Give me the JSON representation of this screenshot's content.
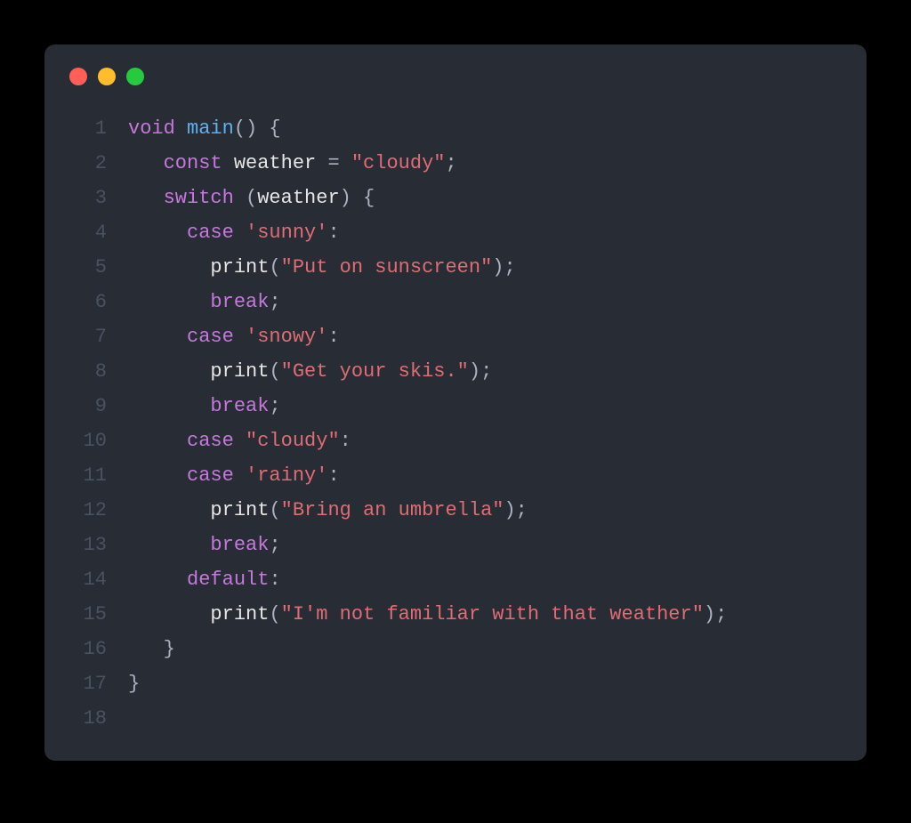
{
  "traffic_lights": {
    "red": "#ff5f56",
    "yellow": "#ffbd2e",
    "green": "#27c93f"
  },
  "code": {
    "lines": [
      {
        "n": "1",
        "tokens": [
          {
            "t": "void",
            "c": "kw"
          },
          {
            "t": " ",
            "c": "op"
          },
          {
            "t": "main",
            "c": "fn"
          },
          {
            "t": "() {",
            "c": "pn"
          }
        ]
      },
      {
        "n": "2",
        "tokens": [
          {
            "t": "   ",
            "c": "op"
          },
          {
            "t": "const",
            "c": "kw"
          },
          {
            "t": " ",
            "c": "op"
          },
          {
            "t": "weather",
            "c": "white"
          },
          {
            "t": " = ",
            "c": "op"
          },
          {
            "t": "\"cloudy\"",
            "c": "strred"
          },
          {
            "t": ";",
            "c": "pn"
          }
        ]
      },
      {
        "n": "3",
        "tokens": [
          {
            "t": "   ",
            "c": "op"
          },
          {
            "t": "switch",
            "c": "kw"
          },
          {
            "t": " (",
            "c": "pn"
          },
          {
            "t": "weather",
            "c": "white"
          },
          {
            "t": ") {",
            "c": "pn"
          }
        ]
      },
      {
        "n": "4",
        "tokens": [
          {
            "t": "     ",
            "c": "op"
          },
          {
            "t": "case",
            "c": "kw"
          },
          {
            "t": " ",
            "c": "op"
          },
          {
            "t": "'sunny'",
            "c": "strred"
          },
          {
            "t": ":",
            "c": "pn"
          }
        ]
      },
      {
        "n": "5",
        "tokens": [
          {
            "t": "       ",
            "c": "op"
          },
          {
            "t": "print",
            "c": "white"
          },
          {
            "t": "(",
            "c": "pn"
          },
          {
            "t": "\"Put on sunscreen\"",
            "c": "strred"
          },
          {
            "t": ");",
            "c": "pn"
          }
        ]
      },
      {
        "n": "6",
        "tokens": [
          {
            "t": "       ",
            "c": "op"
          },
          {
            "t": "break",
            "c": "kw"
          },
          {
            "t": ";",
            "c": "pn"
          }
        ]
      },
      {
        "n": "7",
        "tokens": [
          {
            "t": "     ",
            "c": "op"
          },
          {
            "t": "case",
            "c": "kw"
          },
          {
            "t": " ",
            "c": "op"
          },
          {
            "t": "'snowy'",
            "c": "strred"
          },
          {
            "t": ":",
            "c": "pn"
          }
        ]
      },
      {
        "n": "8",
        "tokens": [
          {
            "t": "       ",
            "c": "op"
          },
          {
            "t": "print",
            "c": "white"
          },
          {
            "t": "(",
            "c": "pn"
          },
          {
            "t": "\"Get your skis.\"",
            "c": "strred"
          },
          {
            "t": ");",
            "c": "pn"
          }
        ]
      },
      {
        "n": "9",
        "tokens": [
          {
            "t": "       ",
            "c": "op"
          },
          {
            "t": "break",
            "c": "kw"
          },
          {
            "t": ";",
            "c": "pn"
          }
        ]
      },
      {
        "n": "10",
        "tokens": [
          {
            "t": "     ",
            "c": "op"
          },
          {
            "t": "case",
            "c": "kw"
          },
          {
            "t": " ",
            "c": "op"
          },
          {
            "t": "\"cloudy\"",
            "c": "strred"
          },
          {
            "t": ":",
            "c": "pn"
          }
        ]
      },
      {
        "n": "11",
        "tokens": [
          {
            "t": "     ",
            "c": "op"
          },
          {
            "t": "case",
            "c": "kw"
          },
          {
            "t": " ",
            "c": "op"
          },
          {
            "t": "'rainy'",
            "c": "strred"
          },
          {
            "t": ":",
            "c": "pn"
          }
        ]
      },
      {
        "n": "12",
        "tokens": [
          {
            "t": "       ",
            "c": "op"
          },
          {
            "t": "print",
            "c": "white"
          },
          {
            "t": "(",
            "c": "pn"
          },
          {
            "t": "\"Bring an umbrella\"",
            "c": "strred"
          },
          {
            "t": ");",
            "c": "pn"
          }
        ]
      },
      {
        "n": "13",
        "tokens": [
          {
            "t": "       ",
            "c": "op"
          },
          {
            "t": "break",
            "c": "kw"
          },
          {
            "t": ";",
            "c": "pn"
          }
        ]
      },
      {
        "n": "14",
        "tokens": [
          {
            "t": "     ",
            "c": "op"
          },
          {
            "t": "default",
            "c": "kw"
          },
          {
            "t": ":",
            "c": "pn"
          }
        ]
      },
      {
        "n": "15",
        "tokens": [
          {
            "t": "       ",
            "c": "op"
          },
          {
            "t": "print",
            "c": "white"
          },
          {
            "t": "(",
            "c": "pn"
          },
          {
            "t": "\"I'm not familiar with that weather\"",
            "c": "strred"
          },
          {
            "t": ");",
            "c": "pn"
          }
        ]
      },
      {
        "n": "16",
        "tokens": [
          {
            "t": "   }",
            "c": "pn"
          }
        ]
      },
      {
        "n": "17",
        "tokens": [
          {
            "t": "}",
            "c": "pn"
          }
        ]
      },
      {
        "n": "18",
        "tokens": [
          {
            "t": "",
            "c": "op"
          }
        ]
      }
    ]
  }
}
